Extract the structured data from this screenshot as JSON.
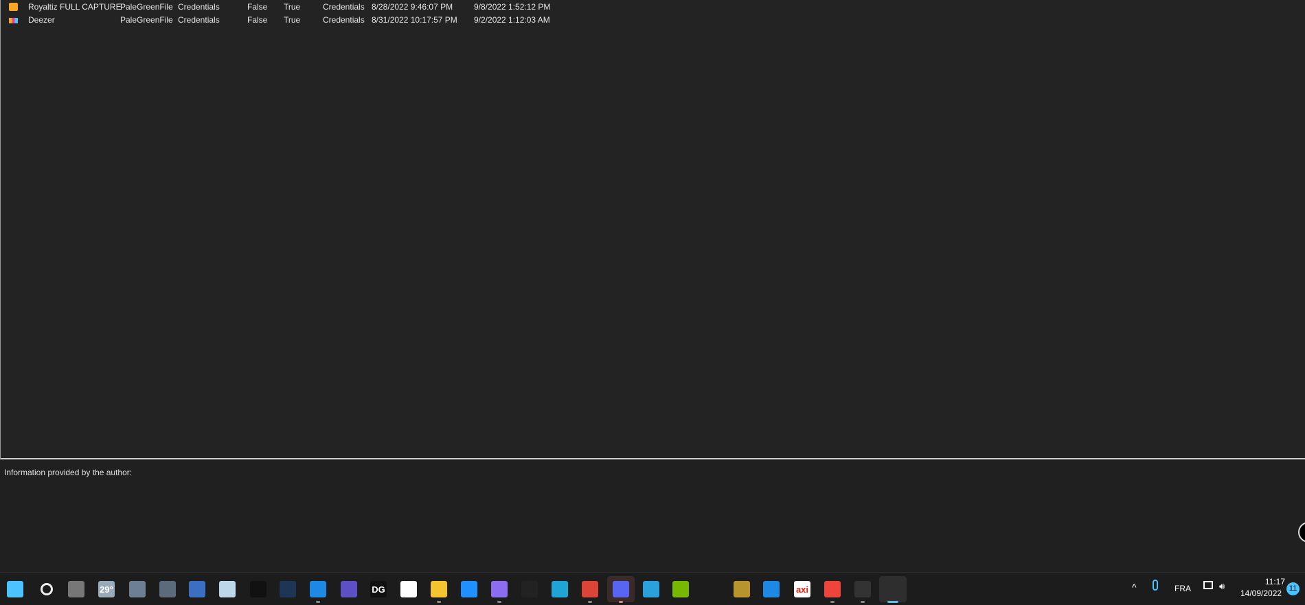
{
  "list": {
    "rows": [
      {
        "icon": "royaltiz-icon",
        "icon_color": "#f5a623",
        "name": "Royaltiz FULL CAPTURE",
        "author": "PaleGreenFile",
        "category": "Credentials",
        "col4": "False",
        "col5": "True",
        "type": "Credentials",
        "created": "8/28/2022 9:46:07 PM",
        "updated": "9/8/2022 1:52:12 PM"
      },
      {
        "icon": "deezer-icon",
        "icon_color": "#e84393",
        "name": "Deezer",
        "author": "PaleGreenFile",
        "category": "Credentials",
        "col4": "False",
        "col5": "True",
        "type": "Credentials",
        "created": "8/31/2022 10:17:57 PM",
        "updated": "9/2/2022 1:12:03 AM"
      }
    ]
  },
  "info": {
    "label": "Information provided by the author:"
  },
  "taskbar": {
    "apps": [
      {
        "name": "start-icon",
        "label": "",
        "color": "#4cc2ff"
      },
      {
        "name": "search-icon",
        "label": "",
        "color": "#1c1c1c"
      },
      {
        "name": "task-view-icon",
        "label": "",
        "color": "#777"
      },
      {
        "name": "weather-icon",
        "label": "29°",
        "color": "#9ab"
      },
      {
        "name": "calculator-icon",
        "label": "",
        "color": "#6d7f93"
      },
      {
        "name": "settings-gear-icon",
        "label": "",
        "color": "#5b6b7b"
      },
      {
        "name": "remote-desktop-icon",
        "label": "",
        "color": "#3a6fc4"
      },
      {
        "name": "resource-monitor-icon",
        "label": "",
        "color": "#bcd6ea"
      },
      {
        "name": "command-prompt-icon",
        "label": "",
        "color": "#111"
      },
      {
        "name": "powershell-icon",
        "label": "",
        "color": "#1f3556"
      },
      {
        "name": "vscode-icon",
        "label": "",
        "color": "#1e88e5",
        "running": true
      },
      {
        "name": "tor-browser-icon",
        "label": "",
        "color": "#5d4fc4"
      },
      {
        "name": "datagrip-icon",
        "label": "DG",
        "color": "#111"
      },
      {
        "name": "ms-store-icon",
        "label": "",
        "color": "#fff"
      },
      {
        "name": "file-explorer-icon",
        "label": "",
        "color": "#f4c430",
        "running": true
      },
      {
        "name": "mail-icon",
        "label": "",
        "color": "#1e90ff"
      },
      {
        "name": "proton-vpn-icon",
        "label": "",
        "color": "#8a6df1",
        "running": true
      },
      {
        "name": "deezer-app-icon",
        "label": "",
        "color": "#222"
      },
      {
        "name": "edge-icon",
        "label": "",
        "color": "#1fa4d8"
      },
      {
        "name": "chrome-icon",
        "label": "",
        "color": "#db4437",
        "running": true
      },
      {
        "name": "discord-icon",
        "label": "",
        "color": "#5865f2",
        "running": true,
        "active": true
      },
      {
        "name": "telegram-icon",
        "label": "",
        "color": "#2aa1da"
      },
      {
        "name": "nvidia-icon",
        "label": "",
        "color": "#76b900"
      },
      {
        "name": "lightning-app-icon",
        "label": "",
        "color": "#1c1c1c"
      },
      {
        "name": "league-of-legends-icon",
        "label": "",
        "color": "#b8942e"
      },
      {
        "name": "notepad-window-icon",
        "label": "",
        "color": "#1e88e5"
      },
      {
        "name": "axi-icon",
        "label": "axi",
        "color": "#fff"
      },
      {
        "name": "anydesk-icon",
        "label": "",
        "color": "#ef443b",
        "running": true
      },
      {
        "name": "terminal-icon",
        "label": "",
        "color": "#333",
        "running": true
      },
      {
        "name": "openbullet-icon",
        "label": "",
        "color": "#2e2e2e",
        "running": true,
        "focused": true
      }
    ],
    "tray": {
      "chevron": "^",
      "language": "FRA",
      "time": "11:17",
      "date": "14/09/2022",
      "notifications": "11"
    }
  }
}
